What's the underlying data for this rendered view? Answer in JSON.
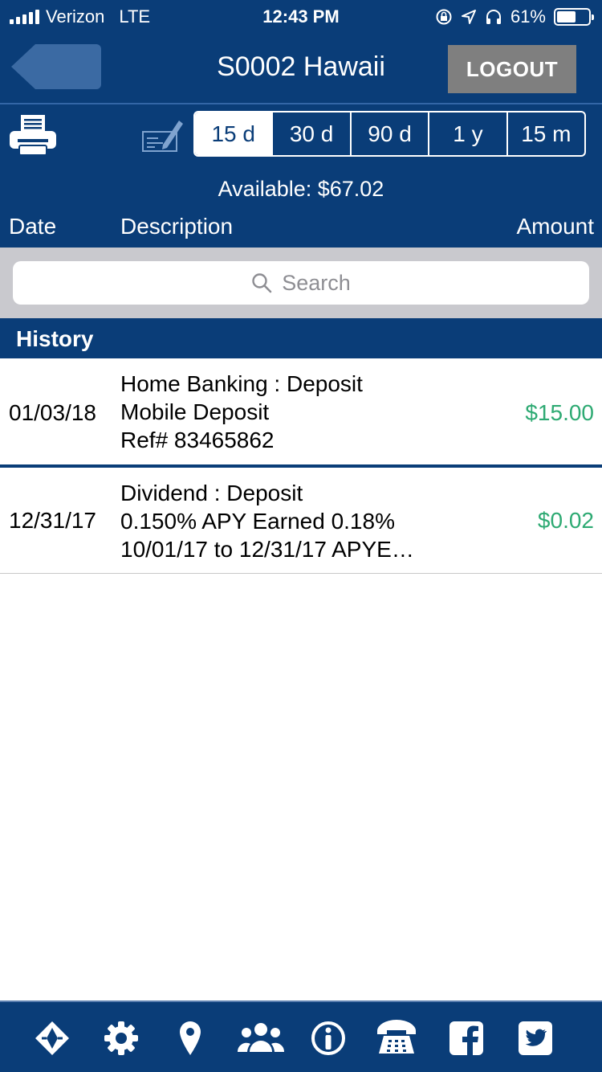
{
  "status_bar": {
    "carrier": "Verizon",
    "network": "LTE",
    "time": "12:43 PM",
    "battery_text": "61%",
    "battery_level": 0.61
  },
  "nav": {
    "title": "S0002 Hawaii",
    "logout_label": "LOGOUT"
  },
  "toolbar": {
    "ranges": [
      {
        "label": "15 d",
        "selected": true
      },
      {
        "label": "30 d",
        "selected": false
      },
      {
        "label": "90 d",
        "selected": false
      },
      {
        "label": "1 y",
        "selected": false
      },
      {
        "label": "15 m",
        "selected": false
      }
    ]
  },
  "available": "Available: $67.02",
  "columns": {
    "date": "Date",
    "description": "Description",
    "amount": "Amount"
  },
  "search": {
    "placeholder": "Search"
  },
  "section_title": "History",
  "transactions": [
    {
      "date": "01/03/18",
      "line1": "Home Banking : Deposit",
      "line2": "Mobile Deposit",
      "line3": "Ref# 83465862",
      "amount": "$15.00"
    },
    {
      "date": "12/31/17",
      "line1": "Dividend : Deposit",
      "line2": "0.150% APY Earned  0.18%",
      "line3": "10/01/17 to 12/31/17 APYE…",
      "amount": "$0.02"
    }
  ],
  "colors": {
    "primary": "#0a3d78",
    "positive_amount": "#2eaa73",
    "logout_bg": "#7f7f7f",
    "search_bg": "#c9c9ce"
  },
  "bottom_tabs": [
    {
      "icon": "diamond-logo-icon"
    },
    {
      "icon": "gear-icon"
    },
    {
      "icon": "location-pin-icon"
    },
    {
      "icon": "people-icon"
    },
    {
      "icon": "info-icon"
    },
    {
      "icon": "phone-icon"
    },
    {
      "icon": "facebook-icon"
    },
    {
      "icon": "twitter-icon"
    }
  ]
}
